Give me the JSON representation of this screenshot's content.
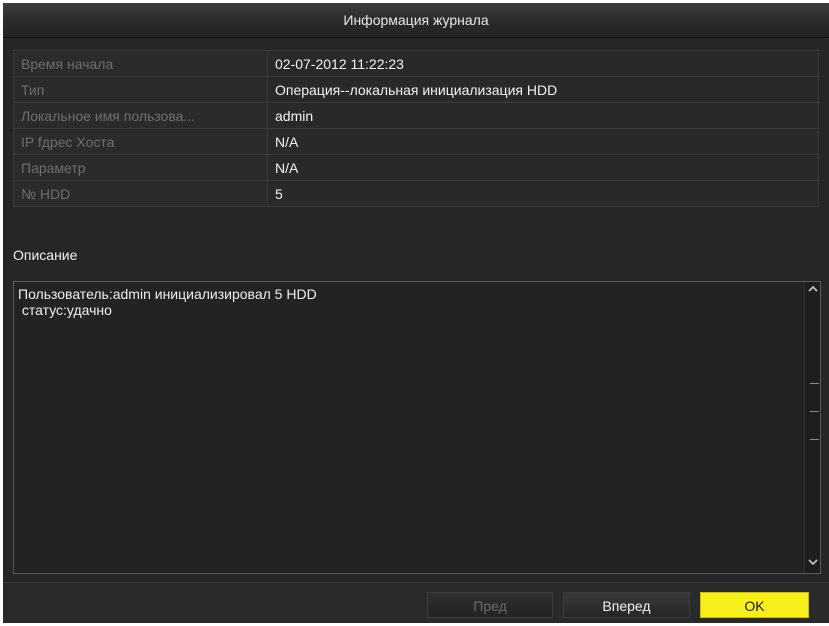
{
  "dialog": {
    "title": "Информация журнала"
  },
  "info": {
    "rows": [
      {
        "label": "Время начала",
        "value": "02-07-2012 11:22:23"
      },
      {
        "label": "Тип",
        "value": "Операция--локальная инициализация HDD"
      },
      {
        "label": "Локальное имя пользова...",
        "value": "admin"
      },
      {
        "label": "IP fдрес Хоста",
        "value": "N/A"
      },
      {
        "label": "Параметр",
        "value": "N/A"
      },
      {
        "label": "№ HDD",
        "value": "5"
      }
    ]
  },
  "description": {
    "label": "Описание",
    "lines": [
      "Пользователь:admin инициализировал 5 HDD",
      " статус:удачно"
    ]
  },
  "scrollbar": {
    "up_icon": "chevron-up-icon",
    "down_icon": "chevron-down-icon"
  },
  "buttons": {
    "prev_label": "Пред",
    "next_label": "Вперед",
    "ok_label": "OK"
  },
  "colors": {
    "background": "#262626",
    "ok_button": "#f8ee1a",
    "disabled_text": "#6b6b6b"
  }
}
